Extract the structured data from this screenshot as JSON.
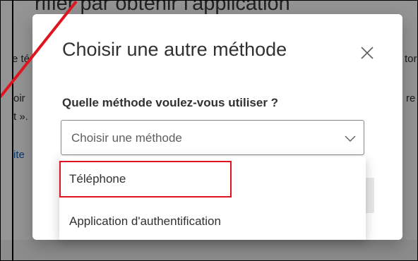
{
  "background": {
    "heading": "rifier par obtenir l'application",
    "fragments": [
      "e té",
      "tor",
      "oir",
      "re",
      "t ».",
      "ite"
    ]
  },
  "dialog": {
    "title": "Choisir une autre méthode",
    "question": "Quelle méthode voulez-vous utiliser ?",
    "select": {
      "placeholder": "Choisir une méthode"
    },
    "options": [
      {
        "label": "Téléphone"
      },
      {
        "label": "Application d'authentification"
      }
    ]
  },
  "colors": {
    "highlight": "#e0141e",
    "link": "#0f5cb7"
  },
  "icons": {
    "close": "close-icon",
    "dropdown": "chevron-down-icon"
  }
}
